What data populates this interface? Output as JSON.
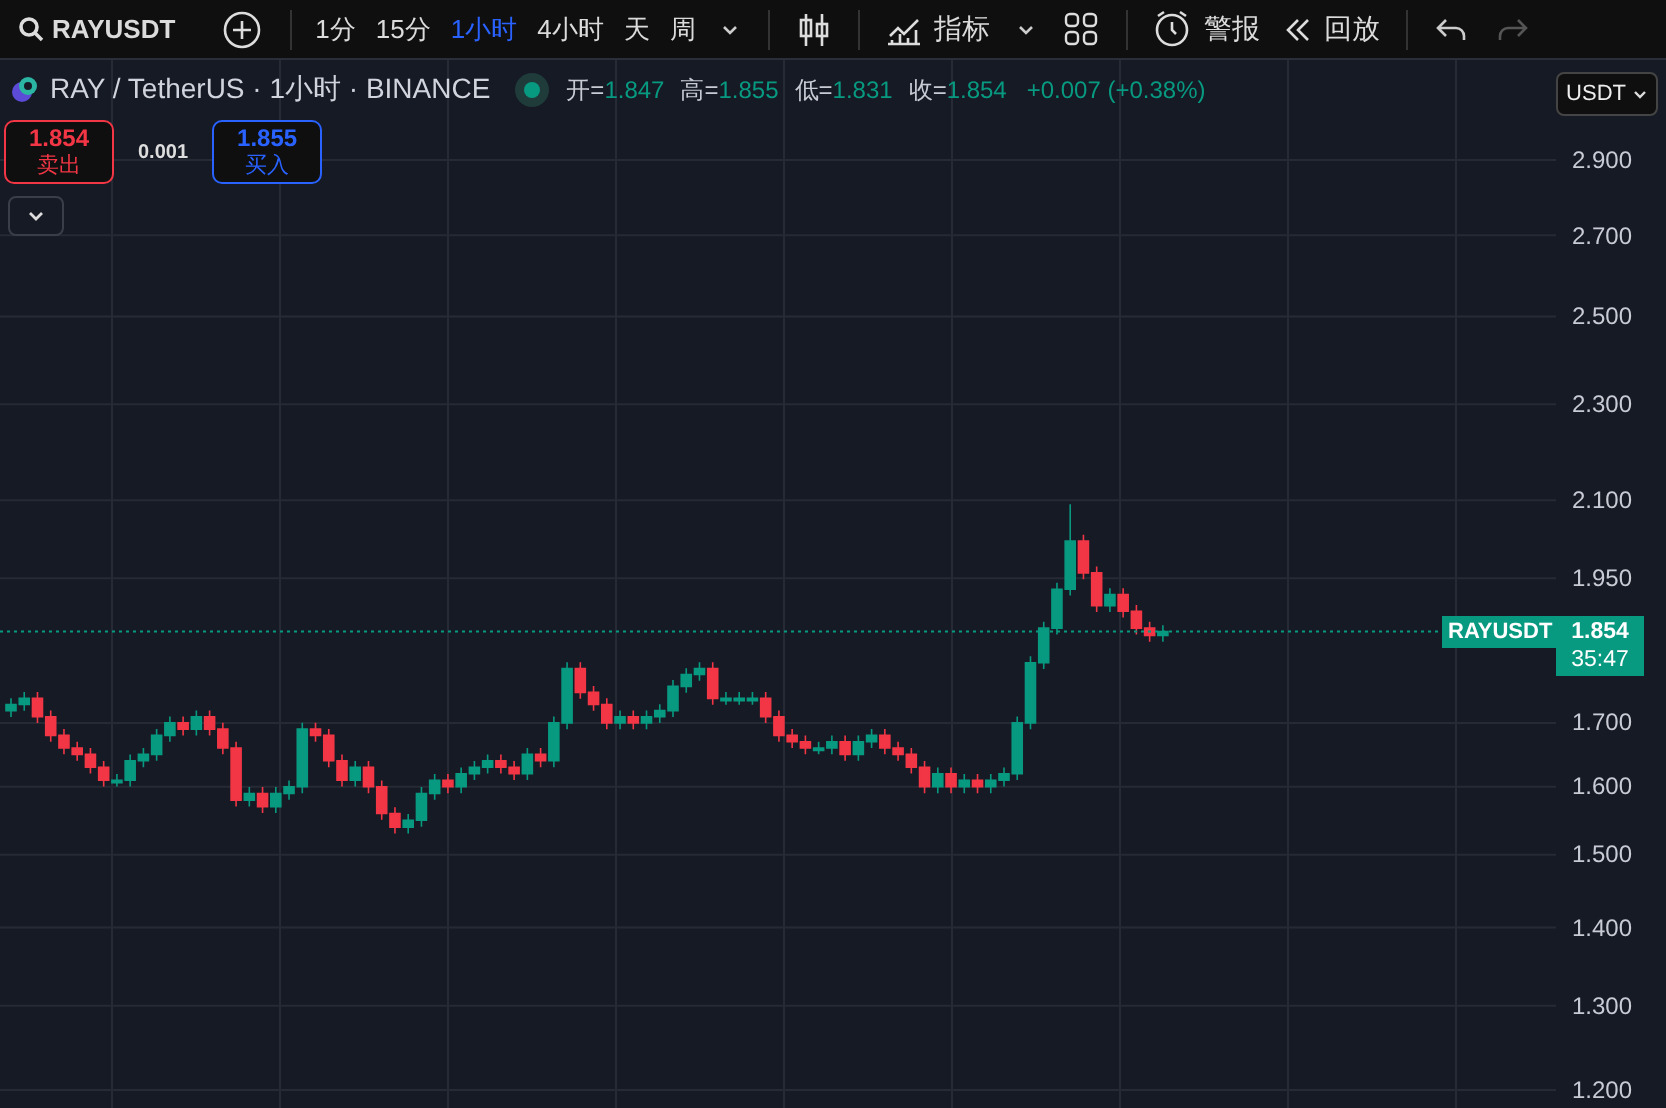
{
  "toolbar": {
    "symbol": "RAYUSDT",
    "intervals": [
      {
        "label": "1分",
        "selected": false
      },
      {
        "label": "15分",
        "selected": false
      },
      {
        "label": "1小时",
        "selected": true
      },
      {
        "label": "4小时",
        "selected": false
      },
      {
        "label": "天",
        "selected": false
      },
      {
        "label": "周",
        "selected": false
      }
    ],
    "indicators": "指标",
    "alert": "警报",
    "replay": "回放",
    "undo": {
      "disabled": false
    },
    "redo": {
      "disabled": true
    }
  },
  "legend": {
    "title": "RAY / TetherUS · 1小时 · BINANCE",
    "ohlc": [
      {
        "label": "开=",
        "value": "1.847"
      },
      {
        "label": "高=",
        "value": "1.855"
      },
      {
        "label": "低=",
        "value": "1.831"
      },
      {
        "label": "收=",
        "value": "1.854"
      }
    ],
    "change": "+0.007 (+0.38%)"
  },
  "trade": {
    "sell": {
      "price": "1.854",
      "label": "卖出"
    },
    "spread": "0.001",
    "buy": {
      "price": "1.855",
      "label": "买入"
    }
  },
  "currency": "USDT",
  "price_axis": [
    "2.900",
    "2.700",
    "2.500",
    "2.300",
    "2.100",
    "1.950",
    "1.700",
    "1.600",
    "1.500",
    "1.400",
    "1.300",
    "1.200"
  ],
  "last_price": {
    "symbol": "RAYUSDT",
    "price": "1.854",
    "countdown": "35:47"
  }
}
